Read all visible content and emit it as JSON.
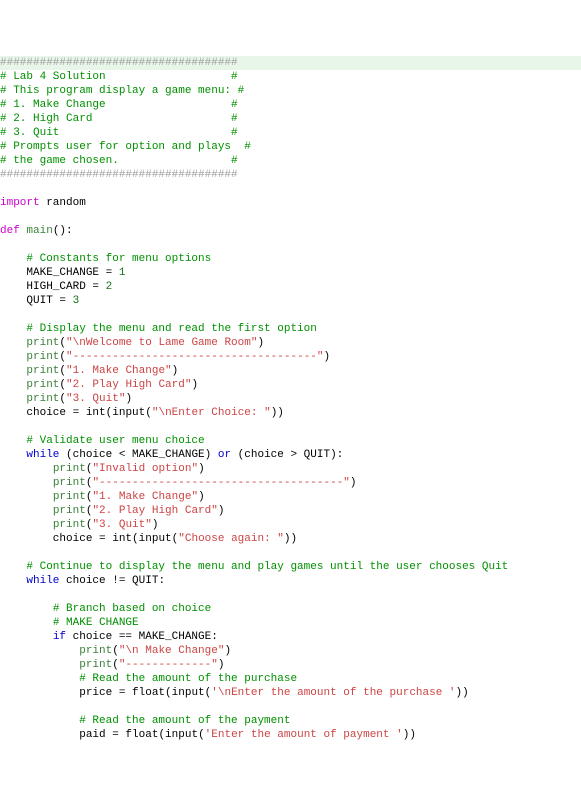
{
  "lines": [
    {
      "cls": "hl-line",
      "segs": [
        {
          "t": "####################################",
          "c": "c"
        }
      ]
    },
    {
      "segs": [
        {
          "t": "# Lab 4 Solution                   #",
          "c": "cm"
        }
      ]
    },
    {
      "segs": [
        {
          "t": "# This program display a game menu: #",
          "c": "cm"
        }
      ]
    },
    {
      "segs": [
        {
          "t": "# 1. Make Change                   #",
          "c": "cm"
        }
      ]
    },
    {
      "segs": [
        {
          "t": "# 2. High Card                     #",
          "c": "cm"
        }
      ]
    },
    {
      "segs": [
        {
          "t": "# 3. Quit                          #",
          "c": "cm"
        }
      ]
    },
    {
      "segs": [
        {
          "t": "# Prompts user for option and plays  #",
          "c": "cm"
        }
      ]
    },
    {
      "segs": [
        {
          "t": "# the game chosen.                 #",
          "c": "cm"
        }
      ]
    },
    {
      "segs": [
        {
          "t": "####################################",
          "c": "c"
        }
      ]
    },
    {
      "segs": [
        {
          "t": "",
          "c": "nm"
        }
      ]
    },
    {
      "segs": [
        {
          "t": "import",
          "c": "kw"
        },
        {
          "t": " random",
          "c": "nm"
        }
      ]
    },
    {
      "segs": [
        {
          "t": "",
          "c": "nm"
        }
      ]
    },
    {
      "segs": [
        {
          "t": "def",
          "c": "kw"
        },
        {
          "t": " ",
          "c": "nm"
        },
        {
          "t": "main",
          "c": "fn"
        },
        {
          "t": "():",
          "c": "nm"
        }
      ]
    },
    {
      "segs": [
        {
          "t": "",
          "c": "nm"
        }
      ]
    },
    {
      "segs": [
        {
          "t": "    ",
          "c": "nm"
        },
        {
          "t": "# Constants for menu options",
          "c": "cm"
        }
      ]
    },
    {
      "segs": [
        {
          "t": "    MAKE_CHANGE = ",
          "c": "nm"
        },
        {
          "t": "1",
          "c": "num"
        }
      ]
    },
    {
      "segs": [
        {
          "t": "    HIGH_CARD = ",
          "c": "nm"
        },
        {
          "t": "2",
          "c": "num"
        }
      ]
    },
    {
      "segs": [
        {
          "t": "    QUIT = ",
          "c": "nm"
        },
        {
          "t": "3",
          "c": "num"
        }
      ]
    },
    {
      "segs": [
        {
          "t": "",
          "c": "nm"
        }
      ]
    },
    {
      "segs": [
        {
          "t": "    ",
          "c": "nm"
        },
        {
          "t": "# Display the menu and read the first option",
          "c": "cm"
        }
      ]
    },
    {
      "segs": [
        {
          "t": "    ",
          "c": "nm"
        },
        {
          "t": "print",
          "c": "fn"
        },
        {
          "t": "(",
          "c": "nm"
        },
        {
          "t": "\"\\nWelcome to Lame Game Room\"",
          "c": "s"
        },
        {
          "t": ")",
          "c": "nm"
        }
      ]
    },
    {
      "segs": [
        {
          "t": "    ",
          "c": "nm"
        },
        {
          "t": "print",
          "c": "fn"
        },
        {
          "t": "(",
          "c": "nm"
        },
        {
          "t": "\"-------------------------------------\"",
          "c": "s"
        },
        {
          "t": ")",
          "c": "nm"
        }
      ]
    },
    {
      "segs": [
        {
          "t": "    ",
          "c": "nm"
        },
        {
          "t": "print",
          "c": "fn"
        },
        {
          "t": "(",
          "c": "nm"
        },
        {
          "t": "\"1. Make Change\"",
          "c": "s"
        },
        {
          "t": ")",
          "c": "nm"
        }
      ]
    },
    {
      "segs": [
        {
          "t": "    ",
          "c": "nm"
        },
        {
          "t": "print",
          "c": "fn"
        },
        {
          "t": "(",
          "c": "nm"
        },
        {
          "t": "\"2. Play High Card\"",
          "c": "s"
        },
        {
          "t": ")",
          "c": "nm"
        }
      ]
    },
    {
      "segs": [
        {
          "t": "    ",
          "c": "nm"
        },
        {
          "t": "print",
          "c": "fn"
        },
        {
          "t": "(",
          "c": "nm"
        },
        {
          "t": "\"3. Quit\"",
          "c": "s"
        },
        {
          "t": ")",
          "c": "nm"
        }
      ]
    },
    {
      "segs": [
        {
          "t": "    choice = ",
          "c": "nm"
        },
        {
          "t": "int",
          "c": "bi"
        },
        {
          "t": "(",
          "c": "nm"
        },
        {
          "t": "input",
          "c": "bi"
        },
        {
          "t": "(",
          "c": "nm"
        },
        {
          "t": "\"\\nEnter Choice: \"",
          "c": "s"
        },
        {
          "t": "))",
          "c": "nm"
        }
      ]
    },
    {
      "segs": [
        {
          "t": "",
          "c": "nm"
        }
      ]
    },
    {
      "segs": [
        {
          "t": "    ",
          "c": "nm"
        },
        {
          "t": "# Validate user menu choice",
          "c": "cm"
        }
      ]
    },
    {
      "segs": [
        {
          "t": "    ",
          "c": "nm"
        },
        {
          "t": "while",
          "c": "kw2"
        },
        {
          "t": " (choice < MAKE_CHANGE) ",
          "c": "nm"
        },
        {
          "t": "or",
          "c": "kw2"
        },
        {
          "t": " (choice > QUIT):",
          "c": "nm"
        }
      ]
    },
    {
      "segs": [
        {
          "t": "        ",
          "c": "nm"
        },
        {
          "t": "print",
          "c": "fn"
        },
        {
          "t": "(",
          "c": "nm"
        },
        {
          "t": "\"Invalid option\"",
          "c": "s"
        },
        {
          "t": ")",
          "c": "nm"
        }
      ]
    },
    {
      "segs": [
        {
          "t": "        ",
          "c": "nm"
        },
        {
          "t": "print",
          "c": "fn"
        },
        {
          "t": "(",
          "c": "nm"
        },
        {
          "t": "\"-------------------------------------\"",
          "c": "s"
        },
        {
          "t": ")",
          "c": "nm"
        }
      ]
    },
    {
      "segs": [
        {
          "t": "        ",
          "c": "nm"
        },
        {
          "t": "print",
          "c": "fn"
        },
        {
          "t": "(",
          "c": "nm"
        },
        {
          "t": "\"1. Make Change\"",
          "c": "s"
        },
        {
          "t": ")",
          "c": "nm"
        }
      ]
    },
    {
      "segs": [
        {
          "t": "        ",
          "c": "nm"
        },
        {
          "t": "print",
          "c": "fn"
        },
        {
          "t": "(",
          "c": "nm"
        },
        {
          "t": "\"2. Play High Card\"",
          "c": "s"
        },
        {
          "t": ")",
          "c": "nm"
        }
      ]
    },
    {
      "segs": [
        {
          "t": "        ",
          "c": "nm"
        },
        {
          "t": "print",
          "c": "fn"
        },
        {
          "t": "(",
          "c": "nm"
        },
        {
          "t": "\"3. Quit\"",
          "c": "s"
        },
        {
          "t": ")",
          "c": "nm"
        }
      ]
    },
    {
      "segs": [
        {
          "t": "        choice = ",
          "c": "nm"
        },
        {
          "t": "int",
          "c": "bi"
        },
        {
          "t": "(",
          "c": "nm"
        },
        {
          "t": "input",
          "c": "bi"
        },
        {
          "t": "(",
          "c": "nm"
        },
        {
          "t": "\"Choose again: \"",
          "c": "s"
        },
        {
          "t": "))",
          "c": "nm"
        }
      ]
    },
    {
      "segs": [
        {
          "t": "",
          "c": "nm"
        }
      ]
    },
    {
      "segs": [
        {
          "t": "    ",
          "c": "nm"
        },
        {
          "t": "# Continue to display the menu and play games until the user chooses Quit",
          "c": "cm"
        }
      ]
    },
    {
      "segs": [
        {
          "t": "    ",
          "c": "nm"
        },
        {
          "t": "while",
          "c": "kw2"
        },
        {
          "t": " choice != QUIT:",
          "c": "nm"
        }
      ]
    },
    {
      "segs": [
        {
          "t": "",
          "c": "nm"
        }
      ]
    },
    {
      "segs": [
        {
          "t": "        ",
          "c": "nm"
        },
        {
          "t": "# Branch based on choice",
          "c": "cm"
        }
      ]
    },
    {
      "segs": [
        {
          "t": "        ",
          "c": "nm"
        },
        {
          "t": "# MAKE CHANGE",
          "c": "cm"
        }
      ]
    },
    {
      "segs": [
        {
          "t": "        ",
          "c": "nm"
        },
        {
          "t": "if",
          "c": "kw2"
        },
        {
          "t": " choice == MAKE_CHANGE:",
          "c": "nm"
        }
      ]
    },
    {
      "segs": [
        {
          "t": "            ",
          "c": "nm"
        },
        {
          "t": "print",
          "c": "fn"
        },
        {
          "t": "(",
          "c": "nm"
        },
        {
          "t": "\"\\n Make Change\"",
          "c": "s"
        },
        {
          "t": ")",
          "c": "nm"
        }
      ]
    },
    {
      "segs": [
        {
          "t": "            ",
          "c": "nm"
        },
        {
          "t": "print",
          "c": "fn"
        },
        {
          "t": "(",
          "c": "nm"
        },
        {
          "t": "\"-------------\"",
          "c": "s"
        },
        {
          "t": ")",
          "c": "nm"
        }
      ]
    },
    {
      "segs": [
        {
          "t": "            ",
          "c": "nm"
        },
        {
          "t": "# Read the amount of the purchase",
          "c": "cm"
        }
      ]
    },
    {
      "segs": [
        {
          "t": "            price = ",
          "c": "nm"
        },
        {
          "t": "float",
          "c": "bi"
        },
        {
          "t": "(",
          "c": "nm"
        },
        {
          "t": "input",
          "c": "bi"
        },
        {
          "t": "(",
          "c": "nm"
        },
        {
          "t": "'\\nEnter the amount of the purchase '",
          "c": "s"
        },
        {
          "t": "))",
          "c": "nm"
        }
      ]
    },
    {
      "segs": [
        {
          "t": "",
          "c": "nm"
        }
      ]
    },
    {
      "segs": [
        {
          "t": "            ",
          "c": "nm"
        },
        {
          "t": "# Read the amount of the payment",
          "c": "cm"
        }
      ]
    },
    {
      "segs": [
        {
          "t": "            paid = ",
          "c": "nm"
        },
        {
          "t": "float",
          "c": "bi"
        },
        {
          "t": "(",
          "c": "nm"
        },
        {
          "t": "input",
          "c": "bi"
        },
        {
          "t": "(",
          "c": "nm"
        },
        {
          "t": "'Enter the amount of payment '",
          "c": "s"
        },
        {
          "t": "))",
          "c": "nm"
        }
      ]
    }
  ]
}
